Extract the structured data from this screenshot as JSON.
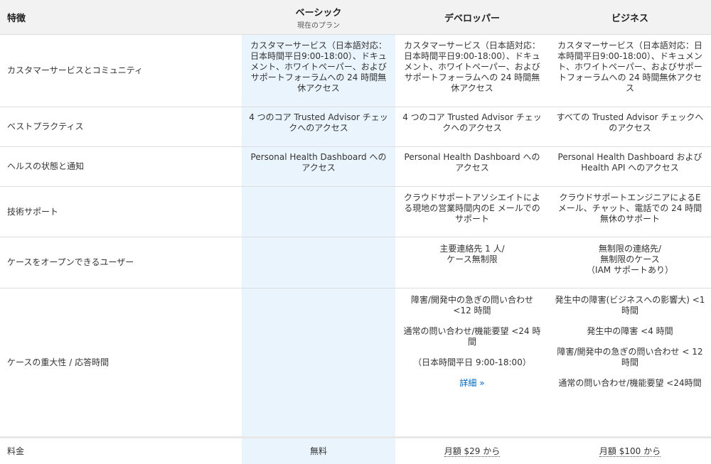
{
  "header": {
    "feature": "特徴",
    "basic": "ベーシック",
    "basic_sub": "現在のプラン",
    "developer": "デベロッパー",
    "business": "ビジネス"
  },
  "rows": [
    {
      "feature": "カスタマーサービスとコミュニティ",
      "basic": "カスタマーサービス（日本語対応：日本時間平日9:00-18:00）、ドキュメント、ホワイトペーパー、およびサポートフォーラムへの 24 時間無休アクセス",
      "developer": "カスタマーサービス（日本語対応：日本時間平日9:00-18:00）、ドキュメント、ホワイトペーパー、およびサポートフォーラムへの 24 時間無休アクセス",
      "business": "カスタマーサービス（日本語対応：日本時間平日9:00-18:00）、ドキュメント、ホワイトペーパー、およびサポートフォーラムへの 24 時間無休アクセス"
    },
    {
      "feature": "ベストプラクティス",
      "basic": "4 つのコア Trusted Advisor チェックへのアクセス",
      "developer": "4 つのコア Trusted Advisor チェックへのアクセス",
      "business": "すべての Trusted Advisor チェックへのアクセス"
    },
    {
      "feature": "ヘルスの状態と通知",
      "basic": "Personal Health Dashboard へのアクセス",
      "developer": "Personal Health Dashboard へのアクセス",
      "business": "Personal Health Dashboard および Health API へのアクセス"
    },
    {
      "feature": "技術サポート",
      "basic": "",
      "developer": "クラウドサポートアソシエイトによる現地の営業時間内のE メールでのサポート",
      "business": "クラウドサポートエンジニアによるE メール、チャット、電話での 24 時間無休のサポート"
    },
    {
      "feature": "ケースをオープンできるユーザー",
      "basic": "",
      "developer": "主要連絡先 1 人/\nケース無制限",
      "business": "無制限の連絡先/\n無制限のケース\n（IAM サポートあり）"
    }
  ],
  "severity": {
    "feature": "ケースの重大性 / 応答時間",
    "developer": [
      "障害/開発中の急ぎの問い合わせ <12 時間",
      "通常の問い合わせ/機能要望 <24 時間",
      "（日本時間平日 9:00-18:00）"
    ],
    "developer_link": "詳細 »",
    "business": [
      "発生中の障害(ビジネスへの影響大) <1 時間",
      "発生中の障害 <4 時間",
      "障害/開発中の急ぎの問い合わせ < 12 時間",
      "通常の問い合わせ/機能要望 <24時間"
    ]
  },
  "price": {
    "feature": "料金",
    "basic": "無料",
    "developer": "月額 $29 から",
    "business": "月額 $100 から"
  },
  "colors": {
    "header_bg": "#f2f2f2",
    "basic_col_bg": "#eaf4fd",
    "link": "#0066c0"
  }
}
